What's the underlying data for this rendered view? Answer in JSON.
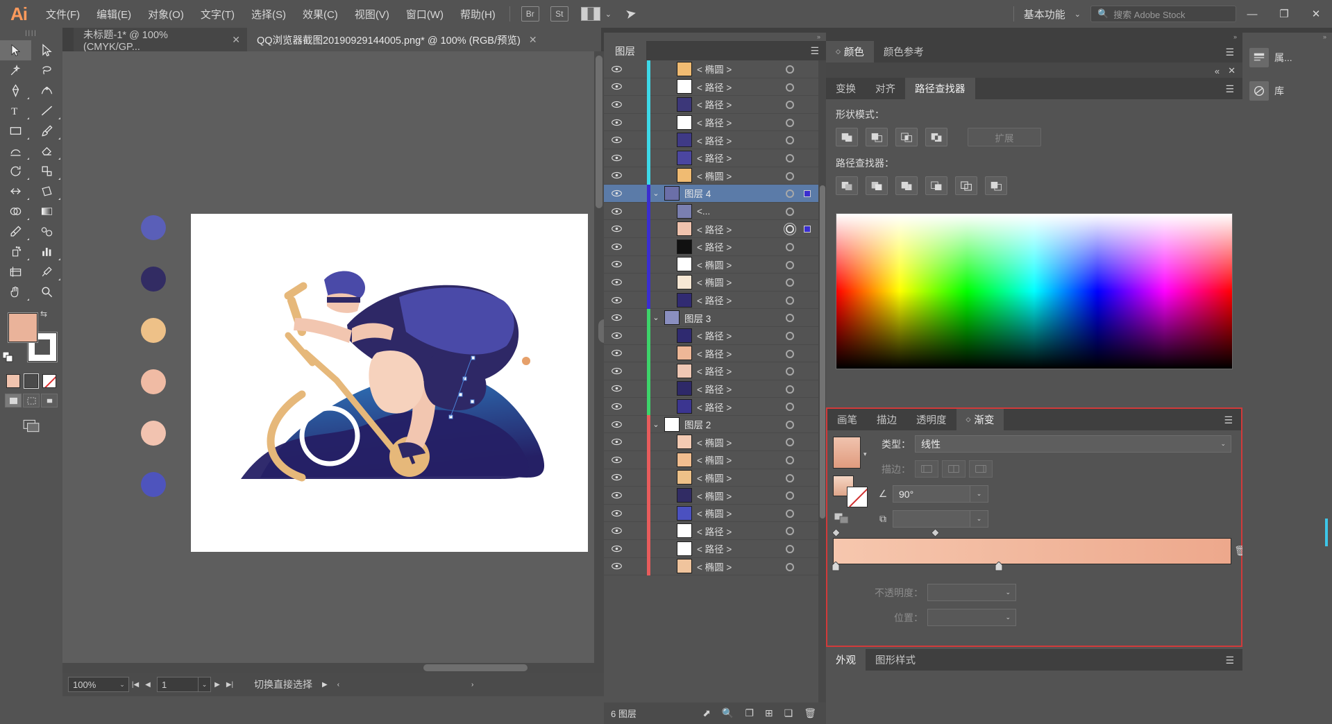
{
  "app": {
    "logo": "Ai",
    "menus": [
      "文件(F)",
      "编辑(E)",
      "对象(O)",
      "文字(T)",
      "选择(S)",
      "效果(C)",
      "视图(V)",
      "窗口(W)",
      "帮助(H)"
    ],
    "quick_buttons": [
      "Br",
      "St"
    ],
    "workspace": "基本功能",
    "search_placeholder": "搜索 Adobe Stock",
    "window_buttons": [
      "—",
      "❐",
      "✕"
    ]
  },
  "tabs": [
    {
      "title": "未标题-1* @ 100% (CMYK/GP...",
      "close": "✕",
      "active": false
    },
    {
      "title": "QQ浏览器截图20190929144005.png* @ 100% (RGB/预览)",
      "close": "✕",
      "active": true
    }
  ],
  "toolbar": {
    "grip": "||||",
    "fill_color": "#eab39a",
    "stroke_color": "#ffffff",
    "rows": [
      [
        "selection-tool",
        "direct-selection-tool"
      ],
      [
        "magic-wand-tool",
        "lasso-tool"
      ],
      [
        "pen-tool",
        "curvature-tool"
      ],
      [
        "type-tool",
        "line-tool"
      ],
      [
        "rectangle-tool",
        "paintbrush-tool"
      ],
      [
        "shaper-tool",
        "eraser-tool"
      ],
      [
        "rotate-tool",
        "scale-tool"
      ],
      [
        "width-tool",
        "free-transform-tool"
      ],
      [
        "shape-builder-tool",
        "gradient-tool"
      ],
      [
        "eyedropper-tool",
        "blend-tool"
      ],
      [
        "symbol-sprayer-tool",
        "column-graph-tool"
      ],
      [
        "artboard-tool",
        "slice-tool"
      ],
      [
        "hand-tool",
        "zoom-tool"
      ]
    ]
  },
  "canvas": {
    "zoom": "100%",
    "page": "1",
    "status_text": "切换直接选择",
    "artboard_swatches": [
      "#5a5fb8",
      "#322c63",
      "#eec188",
      "#f0bba4",
      "#f2c3b0",
      "#4e54bd"
    ]
  },
  "layers_panel": {
    "tab": "图层",
    "footer_count": "6 图层",
    "footer_icons": [
      "locate-object-icon",
      "make-clipping-mask-icon",
      "create-new-sublayer-icon",
      "create-new-layer-icon",
      "delete-selection-icon"
    ],
    "rows": [
      {
        "name": "< 椭圆 >",
        "type": "item",
        "color": "#3dd8e8",
        "thumb": "#f0bb72",
        "selected": false,
        "targeted": false
      },
      {
        "name": "< 路径 >",
        "type": "item",
        "color": "#3dd8e8",
        "thumb": "#ffffff",
        "selected": false,
        "targeted": false
      },
      {
        "name": "< 路径 >",
        "type": "item",
        "color": "#3dd8e8",
        "thumb": "#3c3779",
        "selected": false,
        "targeted": false
      },
      {
        "name": "< 路径 >",
        "type": "item",
        "color": "#3dd8e8",
        "thumb": "#ffffff",
        "selected": false,
        "targeted": false
      },
      {
        "name": "< 路径 >",
        "type": "item",
        "color": "#3dd8e8",
        "thumb": "#3f3a86",
        "selected": false,
        "targeted": false
      },
      {
        "name": "< 路径 >",
        "type": "item",
        "color": "#3dd8e8",
        "thumb": "#4b46a0",
        "selected": false,
        "targeted": false
      },
      {
        "name": "< 椭圆 >",
        "type": "item",
        "color": "#3dd8e8",
        "thumb": "#f0bb72",
        "selected": false,
        "targeted": false
      },
      {
        "name": "图层 4",
        "type": "group",
        "color": "#3a2ed0",
        "thumb": "#6b6fa8",
        "selected": true,
        "targeted": false,
        "expanded": true
      },
      {
        "name": "<...",
        "type": "item",
        "color": "#3a2ed0",
        "thumb": "#7a7fb0",
        "selected": false,
        "targeted": false
      },
      {
        "name": "< 路径 >",
        "type": "item",
        "color": "#3a2ed0",
        "thumb": "#f0c3ae",
        "selected": false,
        "targeted": true
      },
      {
        "name": "< 路径 >",
        "type": "item",
        "color": "#3a2ed0",
        "thumb": "#111111",
        "selected": false,
        "targeted": false
      },
      {
        "name": "< 椭圆 >",
        "type": "item",
        "color": "#3a2ed0",
        "thumb": "#ffffff",
        "selected": false,
        "targeted": false
      },
      {
        "name": "< 椭圆 >",
        "type": "item",
        "color": "#3a2ed0",
        "thumb": "#f6e7d4",
        "selected": false,
        "targeted": false
      },
      {
        "name": "< 路径 >",
        "type": "item",
        "color": "#3a2ed0",
        "thumb": "#312b72",
        "selected": false,
        "targeted": false
      },
      {
        "name": "图层 3",
        "type": "group",
        "color": "#3dd46a",
        "thumb": "#8a8fc0",
        "selected": false,
        "targeted": false,
        "expanded": true
      },
      {
        "name": "< 路径 >",
        "type": "item",
        "color": "#3dd46a",
        "thumb": "#2f2a70",
        "selected": false,
        "targeted": false
      },
      {
        "name": "< 路径 >",
        "type": "item",
        "color": "#3dd46a",
        "thumb": "#eeb797",
        "selected": false,
        "targeted": false
      },
      {
        "name": "< 路径 >",
        "type": "item",
        "color": "#3dd46a",
        "thumb": "#efc7b4",
        "selected": false,
        "targeted": false
      },
      {
        "name": "< 路径 >",
        "type": "item",
        "color": "#3dd46a",
        "thumb": "#2e2968",
        "selected": false,
        "targeted": false
      },
      {
        "name": "< 路径 >",
        "type": "item",
        "color": "#3dd46a",
        "thumb": "#3b3590",
        "selected": false,
        "targeted": false
      },
      {
        "name": "图层 2",
        "type": "group",
        "color": "#e85c5c",
        "thumb": "#ffffff",
        "selected": false,
        "targeted": false,
        "expanded": true
      },
      {
        "name": "< 椭圆 >",
        "type": "item",
        "color": "#e85c5c",
        "thumb": "#f3cab3",
        "selected": false,
        "targeted": false
      },
      {
        "name": "< 椭圆 >",
        "type": "item",
        "color": "#e85c5c",
        "thumb": "#f1bd8f",
        "selected": false,
        "targeted": false
      },
      {
        "name": "< 椭圆 >",
        "type": "item",
        "color": "#e85c5c",
        "thumb": "#eec188",
        "selected": false,
        "targeted": false
      },
      {
        "name": "< 椭圆 >",
        "type": "item",
        "color": "#e85c5c",
        "thumb": "#312c64",
        "selected": false,
        "targeted": false
      },
      {
        "name": "< 椭圆 >",
        "type": "item",
        "color": "#e85c5c",
        "thumb": "#4b51c0",
        "selected": false,
        "targeted": false
      },
      {
        "name": "< 路径 >",
        "type": "item",
        "color": "#e85c5c",
        "thumb": "#ffffff",
        "selected": false,
        "targeted": false
      },
      {
        "name": "< 路径 >",
        "type": "item",
        "color": "#e85c5c",
        "thumb": "#ffffff",
        "selected": false,
        "targeted": false
      },
      {
        "name": "< 椭圆 >",
        "type": "item",
        "color": "#e85c5c",
        "thumb": "#f0c49d",
        "selected": false,
        "targeted": false
      }
    ]
  },
  "color_panel": {
    "tabs": [
      "颜色",
      "颜色参考"
    ],
    "active_tab": "颜色"
  },
  "pathfinder_panel": {
    "tabs": [
      "变换",
      "对齐",
      "路径查找器"
    ],
    "active_tab": "路径查找器",
    "shape_modes_label": "形状模式：",
    "pathfinder_label": "路径查找器：",
    "expand_label": "扩展",
    "shape_mode_buttons": [
      "unite-icon",
      "minus-front-icon",
      "intersect-icon",
      "exclude-icon"
    ],
    "pathfinder_buttons": [
      "divide-icon",
      "trim-icon",
      "merge-icon",
      "crop-icon",
      "outline-icon",
      "minus-back-icon"
    ]
  },
  "gradient_panel": {
    "tabs": [
      "画笔",
      "描边",
      "透明度",
      "渐变"
    ],
    "active_tab": "渐变",
    "type_label": "类型：",
    "type_value": "线性",
    "stroke_label": "描边：",
    "angle_value": "90°",
    "opacity_label": "不透明度：",
    "position_label": "位置：",
    "opacity_value": "",
    "position_value": "",
    "gradient_from": "#f6c7ae",
    "gradient_to": "#eda88c",
    "delete_stop_icon": "trash-icon"
  },
  "appearance_strip": {
    "tabs": [
      "外观",
      "图形样式"
    ],
    "active_tab": "外观"
  },
  "far_dock": {
    "items": [
      {
        "icon": "properties-icon",
        "label": "属..."
      },
      {
        "icon": "libraries-icon",
        "label": "库"
      }
    ]
  }
}
